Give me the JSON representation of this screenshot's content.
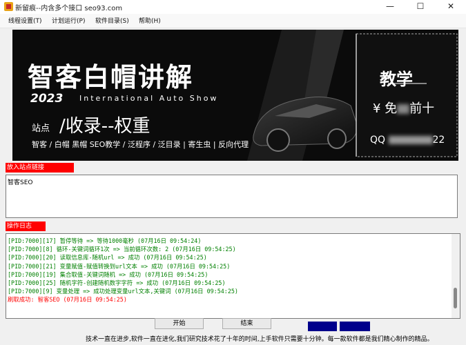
{
  "window": {
    "title": "新留痕--内含多个接口 seo93.com",
    "minimize_glyph": "—",
    "maximize_glyph": "☐",
    "close_glyph": "✕"
  },
  "menu": {
    "items": [
      {
        "label": "线程设置(T)"
      },
      {
        "label": "计划运行(P)"
      },
      {
        "label": "软件目录(S)"
      },
      {
        "label": "帮助(H)"
      }
    ]
  },
  "banner": {
    "title": "智客白帽讲解",
    "year": "2023",
    "subtitle": "International Auto Show",
    "station": "站点",
    "slogan": "/收录--权重",
    "tags": "智客 / 白帽 黑帽 SEO教学 / 泛程序 / 泛目录 | 寄生虫 | 反向代理",
    "teach": "教学",
    "free_prefix": "¥ 免",
    "free_suffix": "前十",
    "qq_prefix": "QQ",
    "qq_suffix": "22"
  },
  "input_section": {
    "label": "放入站点链接",
    "value": "智客SEO"
  },
  "log_section": {
    "label": "操作日志",
    "lines": [
      {
        "text": "[PID:7000][17] 暂停等待 => 等待1000毫秒 (07月16日 09:54:24)",
        "color": "#008000"
      },
      {
        "text": "[PID:7000][8] 循环-关键词循环1次 => 当前循环次数: 2 (07月16日 09:54:25)",
        "color": "#008000"
      },
      {
        "text": "[PID:7000][20] 读取信息库-随机url => 成功 (07月16日 09:54:25)",
        "color": "#008000"
      },
      {
        "text": "[PID:7000][21] 变量赋值-赋值转换到url文本 => 成功 (07月16日 09:54:25)",
        "color": "#008000"
      },
      {
        "text": "[PID:7000][19] 集合取值-关键词随机 => 成功 (07月16日 09:54:25)",
        "color": "#008000"
      },
      {
        "text": "[PID:7000][25] 随机字符-创建随机数字字符 => 成功 (07月16日 09:54:25)",
        "color": "#008000"
      },
      {
        "text": "[PID:7000][9] 变量处理 => 成功处理变量url文本,关键词 (07月16日 09:54:25)",
        "color": "#008000"
      },
      {
        "text": "刷取成功: 智客SEO (07月16日 09:54:25)",
        "color": "#ff0000"
      }
    ]
  },
  "buttons": {
    "start": "开始",
    "stop": "结束",
    "blue1": "",
    "blue2": ""
  },
  "status": {
    "text": "技术一直在进步,软件一直在进化,我们研究技术花了十年的时间,上手软件只需要十分钟。每一款软件都是我们精心制作的精品。"
  },
  "colors": {
    "label_red": "#ff0000",
    "log_green": "#008000",
    "blue_button": "#00008b"
  }
}
